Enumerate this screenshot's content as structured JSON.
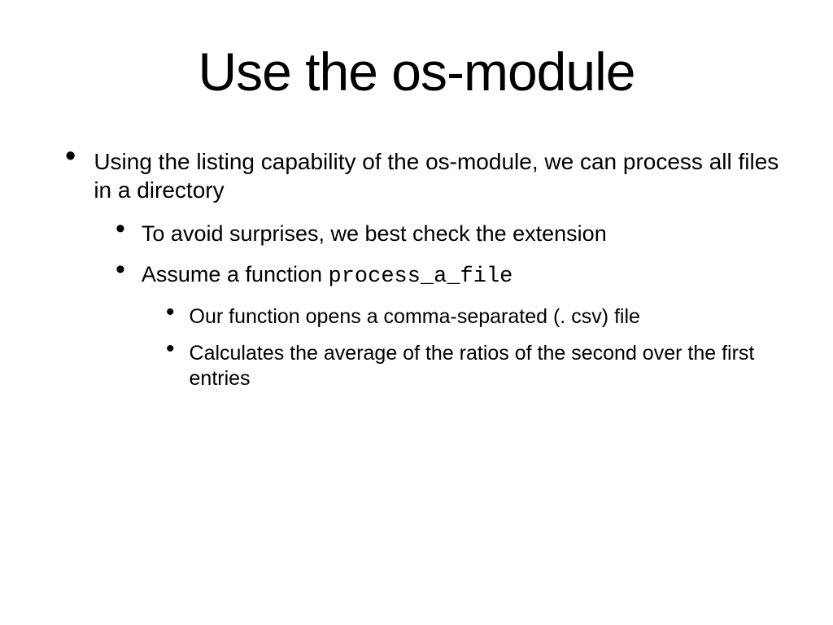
{
  "title": "Use the os-module",
  "bullets": {
    "l1": {
      "text": "Using the listing capability of the os-module, we can process all files in a directory"
    },
    "l2": {
      "item1": "To avoid surprises, we best check the extension",
      "item2_prefix": "Assume a function ",
      "item2_code": "process_a_file"
    },
    "l3": {
      "item1": "Our function opens a comma-separated (. csv) file",
      "item2": "Calculates the average of the ratios of the second over the first entries"
    }
  }
}
